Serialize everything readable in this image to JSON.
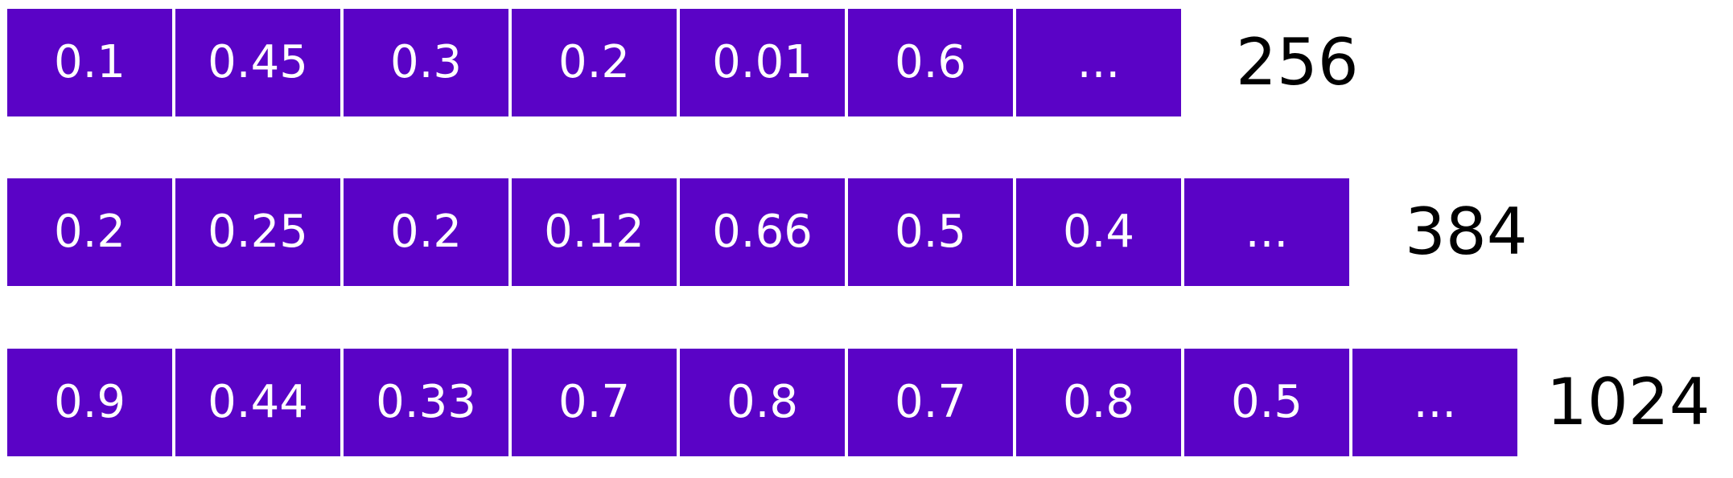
{
  "vectors": [
    {
      "cells": [
        "0.1",
        "0.45",
        "0.3",
        "0.2",
        "0.01",
        "0.6",
        "..."
      ],
      "dimension": "256"
    },
    {
      "cells": [
        "0.2",
        "0.25",
        "0.2",
        "0.12",
        "0.66",
        "0.5",
        "0.4",
        "..."
      ],
      "dimension": "384"
    },
    {
      "cells": [
        "0.9",
        "0.44",
        "0.33",
        "0.7",
        "0.8",
        "0.7",
        "0.8",
        "0.5",
        "..."
      ],
      "dimension": "1024"
    }
  ],
  "colors": {
    "cell_background": "#5a03c6",
    "cell_text": "#ffffff",
    "label_text": "#000000"
  }
}
